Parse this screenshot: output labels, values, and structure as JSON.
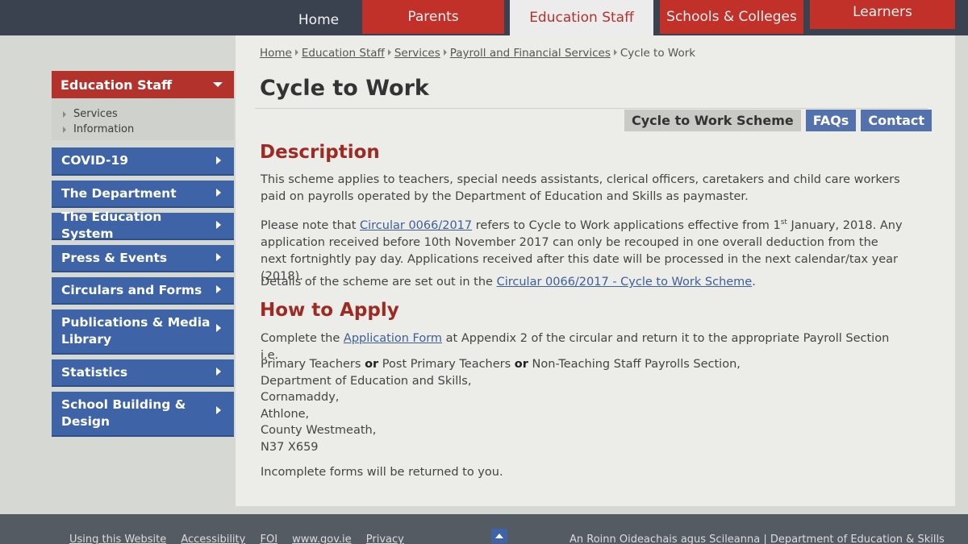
{
  "topnav": {
    "home": "Home",
    "parents": "Parents",
    "staff": "Education Staff",
    "schools": "Schools & Colleges",
    "learners": "Learners"
  },
  "sidebar": {
    "section": "Education Staff",
    "subitems": [
      "Services",
      "Information"
    ],
    "items": [
      "COVID-19",
      "The Department",
      "The Education System",
      "Press & Events",
      "Circulars and Forms",
      "Publications & Media Library",
      "Statistics",
      "School Building & Design"
    ]
  },
  "breadcrumb": [
    "Home",
    "Education Staff",
    "Services",
    "Payroll and Financial Services",
    "Cycle to Work"
  ],
  "page_title": "Cycle to Work",
  "buttons": {
    "scheme": "Cycle to Work Scheme",
    "faqs": "FAQs",
    "contact": "Contact"
  },
  "description": {
    "heading": "Description",
    "p1": "This scheme applies to teachers, special needs assistants, clerical officers, caretakers and child care workers paid on payrolls operated by the Department of Education and Skills as paymaster.",
    "p2_pre": "Please note that ",
    "p2_link": "Circular 0066/2017",
    "p2_mid": " refers to Cycle to Work applications effective from 1",
    "p2_sup": "st",
    "p2_post": " January, 2018.  Any application received before 10th November 2017 can only be recouped in one overall deduction from the next fortnightly pay day.  Applications received after this date will be processed in the next calendar/tax year (2018).",
    "p3_pre": "Details of the scheme are set out in the ",
    "p3_link": "Circular 0066/2017 - Cycle to Work Scheme",
    "p3_post": "."
  },
  "apply": {
    "heading": "How to Apply",
    "p1_pre": "Complete the ",
    "p1_link": "Application Form",
    "p1_post": " at Appendix 2 of the circular and return it to the appropriate Payroll Section i.e.",
    "addr_a": "Primary Teachers ",
    "or1": "or",
    "addr_b": " Post Primary Teachers ",
    "or2": "or",
    "addr_c": " Non-Teaching Staff Payrolls Section,",
    "address_lines": [
      "Department of Education and Skills,",
      "Cornamaddy,",
      "Athlone,",
      "County Westmeath,",
      "N37 X659"
    ],
    "closing": "Incomplete forms will be returned to you."
  },
  "footer": {
    "links": [
      "Using this Website",
      "Accessibility",
      "FOI",
      "www.gov.ie",
      "Privacy"
    ],
    "right": "An Roinn Oideachais agus Scileanna | Department of Education & Skills"
  }
}
